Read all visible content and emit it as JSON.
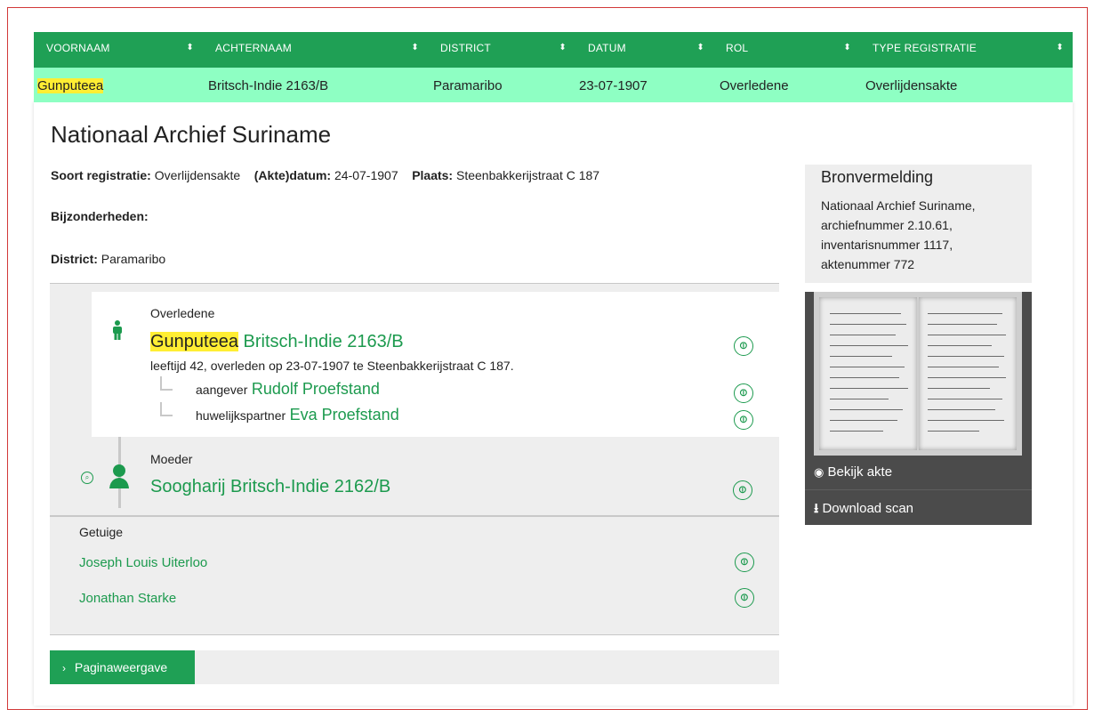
{
  "table": {
    "headers": [
      "VOORNAAM",
      "ACHTERNAAM",
      "DISTRICT",
      "DATUM",
      "ROL",
      "TYPE REGISTRATIE"
    ],
    "sort_icon": "⬍",
    "row": {
      "voornaam": "Gunputeea",
      "achternaam": "Britsch-Indie 2163/B",
      "district": "Paramaribo",
      "datum": "23-07-1907",
      "rol": "Overledene",
      "type": "Overlijdensakte"
    }
  },
  "record": {
    "title": "Nationaal Archief Suriname",
    "soort_label": "Soort registratie:",
    "soort_value": "Overlijdensakte",
    "akte_label": "(Akte)datum:",
    "akte_value": "24-07-1907",
    "plaats_label": "Plaats:",
    "plaats_value": "Steenbakkerijstraat C 187",
    "bijzonderheden_label": "Bijzonderheden:",
    "district_label": "District:",
    "district_value": "Paramaribo"
  },
  "main_person": {
    "role": "Overledene",
    "first_name": "Gunputeea",
    "last_name": "Britsch-Indie 2163/B",
    "details": "leeftijd 42, overleden op 23-07-1907 te Steenbakkerijstraat C 187.",
    "relations": [
      {
        "role": "aangever",
        "name": "Rudolf Proefstand"
      },
      {
        "role": "huwelijkspartner",
        "name": "Eva Proefstand"
      }
    ]
  },
  "mother": {
    "role": "Moeder",
    "name": "Soogharij Britsch-Indie 2162/B"
  },
  "witnesses": {
    "label": "Getuige",
    "names": [
      "Joseph Louis Uiterloo",
      "Jonathan Starke"
    ]
  },
  "source": {
    "title": "Bronvermelding",
    "lines": [
      "Nationaal Archief Suriname,",
      "archiefnummer 2.10.61,",
      "inventarisnummer 1117,",
      "aktenummer 772"
    ]
  },
  "scan": {
    "view_label": "Bekijk akte",
    "download_label": "Download scan"
  },
  "footer": {
    "pagina_label": "Paginaweergave"
  },
  "colors": {
    "accent": "#1fa055",
    "row_bg": "#8effc3",
    "highlight": "#ffee33",
    "link": "#1c9a4e"
  },
  "icons": [
    "sort-icon",
    "person-male-icon",
    "person-female-icon",
    "link-icon",
    "eye-icon",
    "download-icon",
    "chevron-right-icon",
    "corner-connector-icon",
    "search-circle-icon"
  ]
}
